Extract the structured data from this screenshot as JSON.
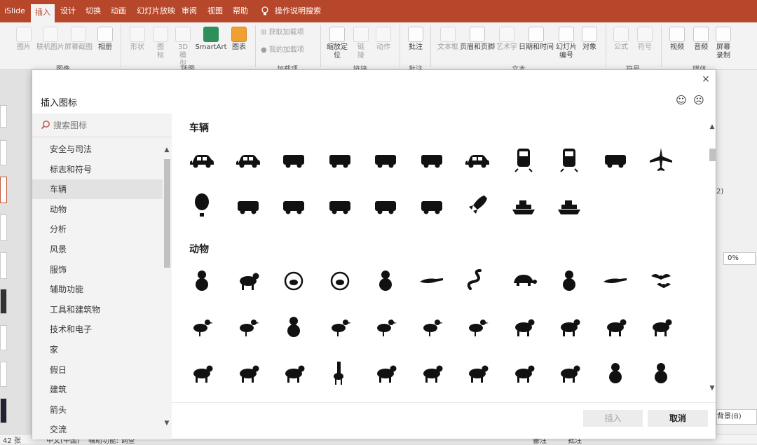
{
  "app": {
    "name": "iSlide",
    "tabs": [
      "插入",
      "设计",
      "切换",
      "动画",
      "幻灯片放映",
      "审阅",
      "视图",
      "帮助"
    ],
    "tell_me": "操作说明搜索"
  },
  "ribbon": {
    "buttons": [
      "图片",
      "联机图片",
      "屏幕截图",
      "相册",
      "形状",
      "图标",
      "3D模型",
      "SmartArt",
      "图表",
      "获取加载项",
      "我的加载项",
      "缩放定位",
      "链接",
      "动作",
      "批注",
      "文本框",
      "页眉和页脚",
      "艺术字",
      "日期和时间",
      "幻灯片编号",
      "对象",
      "公式",
      "符号",
      "视频",
      "音频",
      "屏幕录制"
    ],
    "groups": [
      "图像",
      "插图",
      "加载项",
      "链接",
      "批注",
      "文本",
      "符号",
      "媒体"
    ]
  },
  "status": {
    "slide_count": "42 张",
    "language": "中文(中国)",
    "accessibility": "辅助功能: 调查",
    "notes": "备注",
    "comments": "批注"
  },
  "background_panel": {
    "percent": "0%",
    "bg_button": "背景(B)",
    "fragment": "2)"
  },
  "dialog": {
    "title": "插入图标",
    "close_glyph": "×",
    "smile": "☺",
    "frown": "☹",
    "search_placeholder": "搜索图标",
    "categories": [
      "安全与司法",
      "标志和符号",
      "车辆",
      "动物",
      "分析",
      "风景",
      "服饰",
      "辅助功能",
      "工具和建筑物",
      "技术和电子",
      "家",
      "假日",
      "建筑",
      "箭头",
      "交流"
    ],
    "selected_category": "车辆",
    "sections": [
      {
        "title": "车辆",
        "icons": [
          "car-icon",
          "electric-car-icon",
          "truck-icon",
          "motorcycle-icon",
          "scooter-icon",
          "bus-icon",
          "taxi-icon",
          "train-icon",
          "tram-icon",
          "helicopter-icon",
          "airplane-icon",
          "hot-air-balloon-icon",
          "dump-truck-icon",
          "bulldozer-icon",
          "cement-mixer-icon",
          "excavator-icon",
          "tractor-icon",
          "rocket-icon",
          "cruise-ship-icon",
          "steamship-icon"
        ]
      },
      {
        "title": "动物",
        "icons": [
          "cat-icon",
          "dog-icon",
          "fishbowl-icon",
          "hamster-wheel-icon",
          "rabbit-icon",
          "mouse-icon",
          "snake-icon",
          "turtle-icon",
          "frog-icon",
          "crocodile-icon",
          "bats-icon",
          "bird-icon",
          "hummingbird-icon",
          "owl-icon",
          "peacock-icon",
          "duck-icon",
          "hen-icon",
          "rooster-icon",
          "cow-icon",
          "goat-icon",
          "horse-icon",
          "pig-icon",
          "sheep-icon",
          "deer-icon",
          "zebra-icon",
          "giraffe-icon",
          "elephant-icon",
          "rhino-icon",
          "hippo-icon",
          "lion-icon",
          "tiger-icon",
          "monkey-icon",
          "gorilla-icon"
        ]
      }
    ],
    "insert_label": "插入",
    "cancel_label": "取消"
  }
}
